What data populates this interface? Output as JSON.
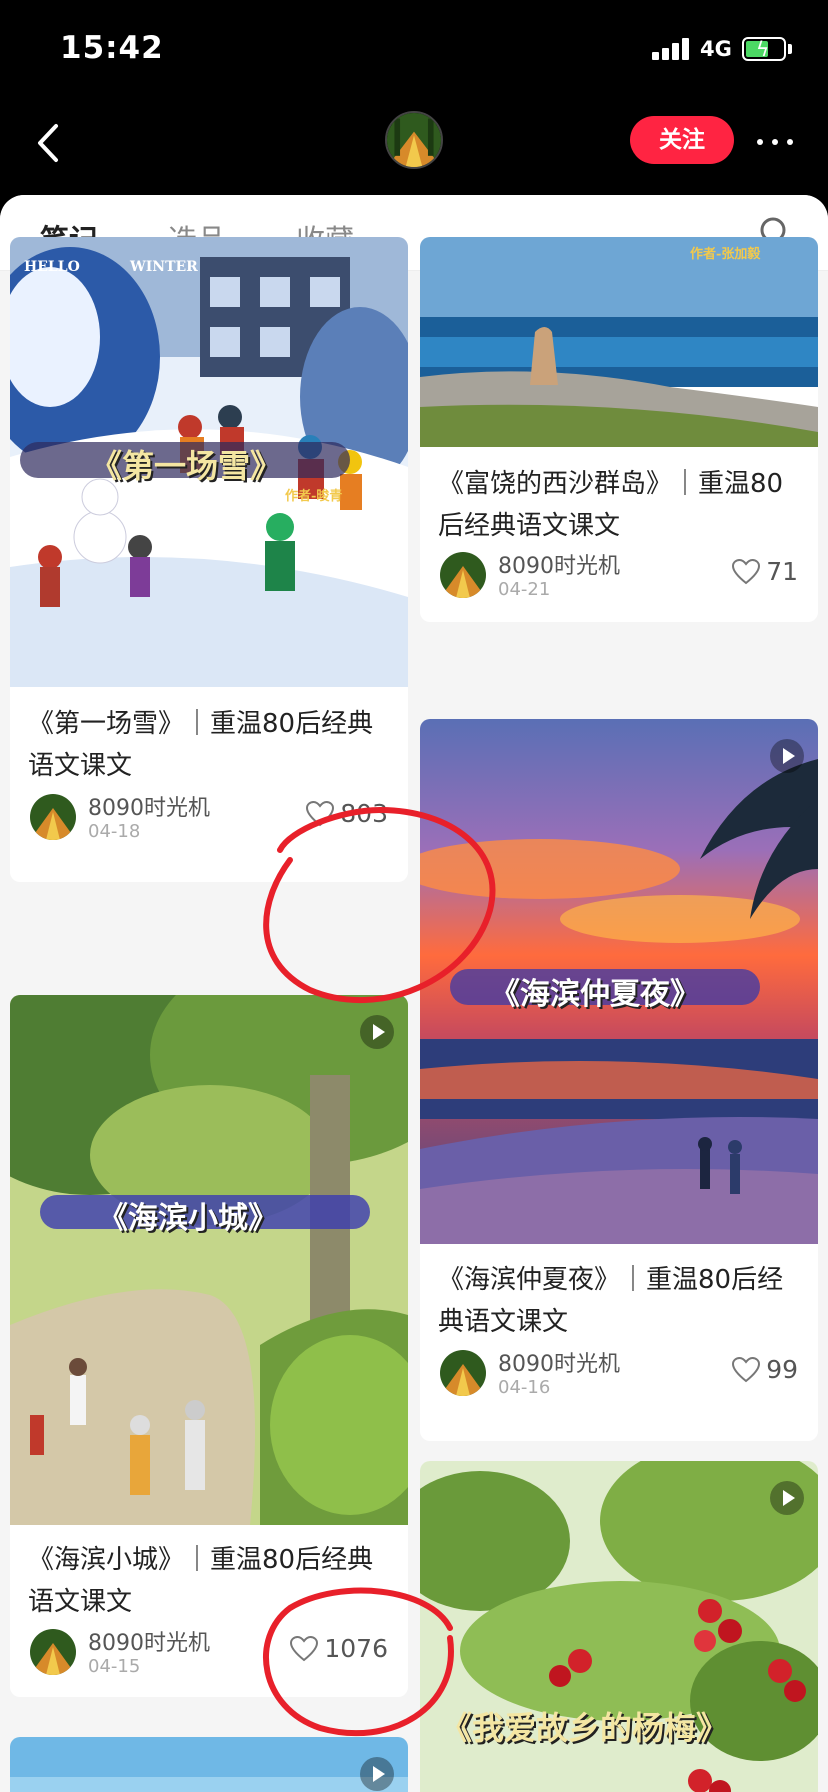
{
  "status_bar": {
    "time": "15:42",
    "network": "4G"
  },
  "nav": {
    "follow_label": "关注"
  },
  "tabs": [
    {
      "label": "笔记"
    },
    {
      "label": "选品"
    },
    {
      "label": "收藏"
    }
  ],
  "colors": {
    "accent": "#ff2442",
    "annotation": "#e8202a"
  },
  "notes": [
    {
      "title": "《第一场雪》｜重温80后经典语文课文",
      "author": "8090时光机",
      "date": "04-18",
      "likes": "803",
      "cover_banner": "《第一场雪》",
      "cover_caption": "作者-晙青",
      "cover_corner_left": "HELLO",
      "cover_corner_right": "WINTER"
    },
    {
      "title": "《富饶的西沙群岛》｜重温80后经典语文课文",
      "author": "8090时光机",
      "date": "04-21",
      "likes": "71",
      "cover_caption": "作者-张加毅"
    },
    {
      "title": "《海滨仲夏夜》｜重温80后经典语文课文",
      "author": "8090时光机",
      "date": "04-16",
      "likes": "99",
      "cover_banner": "《海滨仲夏夜》"
    },
    {
      "title": "《海滨小城》｜重温80后经典语文课文",
      "author": "8090时光机",
      "date": "04-15",
      "likes": "1076",
      "cover_banner": "《海滨小城》"
    },
    {
      "cover_banner": "《我爱故乡的杨梅》"
    }
  ]
}
